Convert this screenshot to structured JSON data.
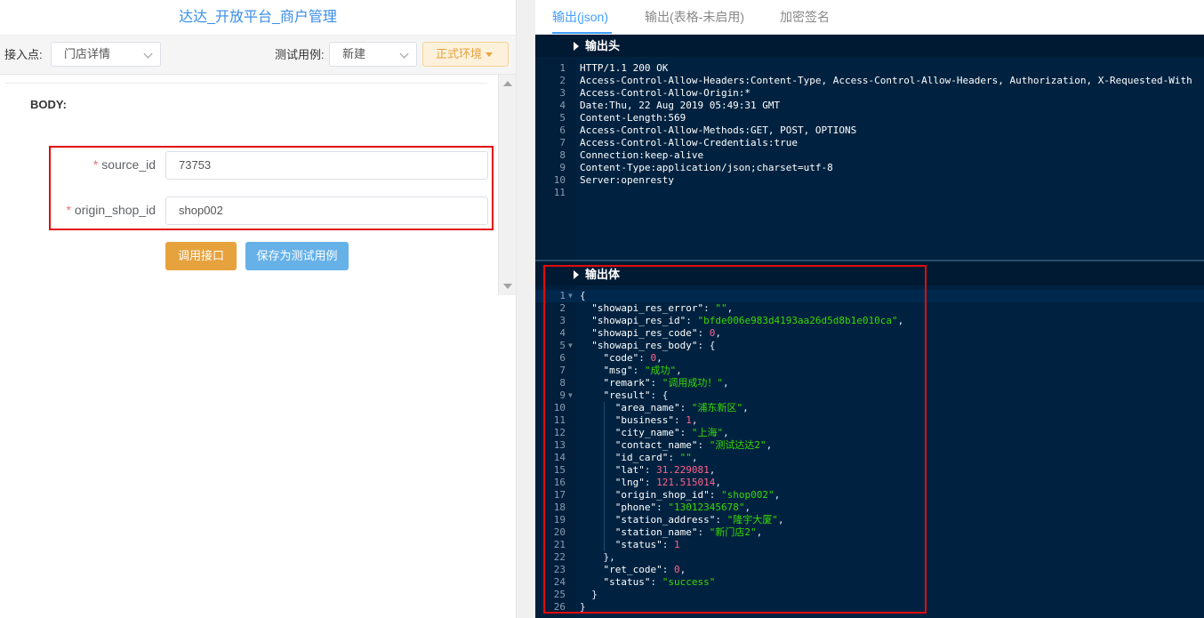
{
  "left": {
    "app_title": "达达_开放平台_商户管理",
    "access_point_label": "接入点:",
    "access_point_value": "门店详情",
    "test_case_label": "测试用例:",
    "test_case_value": "新建",
    "env_button": "正式环境",
    "body_title": "BODY:",
    "fields": [
      {
        "label": "source_id",
        "value": "73753"
      },
      {
        "label": "origin_shop_id",
        "value": "shop002"
      }
    ],
    "call_button": "调用接口",
    "save_button": "保存为测试用例"
  },
  "right": {
    "tabs": [
      {
        "label": "输出(json)"
      },
      {
        "label": "输出(表格-未启用)"
      },
      {
        "label": "加密签名"
      }
    ],
    "header_section_title": "输出头",
    "body_section_title": "输出体",
    "header_lines": [
      "HTTP/1.1 200 OK",
      "Access-Control-Allow-Headers:Content-Type, Access-Control-Allow-Headers, Authorization, X-Requested-With",
      "Access-Control-Allow-Origin:*",
      "Date:Thu, 22 Aug 2019 05:49:31 GMT",
      "Content-Length:569",
      "Access-Control-Allow-Methods:GET, POST, OPTIONS",
      "Access-Control-Allow-Credentials:true",
      "Connection:keep-alive",
      "Content-Type:application/json;charset=utf-8",
      "Server:openresty",
      ""
    ],
    "body_lines": [
      [
        {
          "t": "p",
          "v": "{"
        }
      ],
      [
        {
          "t": "p",
          "v": "  "
        },
        {
          "t": "k",
          "v": "\"showapi_res_error\""
        },
        {
          "t": "p",
          "v": ": "
        },
        {
          "t": "s",
          "v": "\"\""
        },
        {
          "t": "p",
          "v": ","
        }
      ],
      [
        {
          "t": "p",
          "v": "  "
        },
        {
          "t": "k",
          "v": "\"showapi_res_id\""
        },
        {
          "t": "p",
          "v": ": "
        },
        {
          "t": "s",
          "v": "\"bfde006e983d4193aa26d5d8b1e010ca\""
        },
        {
          "t": "p",
          "v": ","
        }
      ],
      [
        {
          "t": "p",
          "v": "  "
        },
        {
          "t": "k",
          "v": "\"showapi_res_code\""
        },
        {
          "t": "p",
          "v": ": "
        },
        {
          "t": "n",
          "v": "0"
        },
        {
          "t": "p",
          "v": ","
        }
      ],
      [
        {
          "t": "p",
          "v": "  "
        },
        {
          "t": "k",
          "v": "\"showapi_res_body\""
        },
        {
          "t": "p",
          "v": ": {"
        }
      ],
      [
        {
          "t": "p",
          "v": "    "
        },
        {
          "t": "k",
          "v": "\"code\""
        },
        {
          "t": "p",
          "v": ": "
        },
        {
          "t": "n",
          "v": "0"
        },
        {
          "t": "p",
          "v": ","
        }
      ],
      [
        {
          "t": "p",
          "v": "    "
        },
        {
          "t": "k",
          "v": "\"msg\""
        },
        {
          "t": "p",
          "v": ": "
        },
        {
          "t": "s",
          "v": "\"成功\""
        },
        {
          "t": "p",
          "v": ","
        }
      ],
      [
        {
          "t": "p",
          "v": "    "
        },
        {
          "t": "k",
          "v": "\"remark\""
        },
        {
          "t": "p",
          "v": ": "
        },
        {
          "t": "s",
          "v": "\"调用成功！\""
        },
        {
          "t": "p",
          "v": ","
        }
      ],
      [
        {
          "t": "p",
          "v": "    "
        },
        {
          "t": "k",
          "v": "\"result\""
        },
        {
          "t": "p",
          "v": ": {"
        }
      ],
      [
        {
          "t": "p",
          "v": "      "
        },
        {
          "t": "k",
          "v": "\"area_name\""
        },
        {
          "t": "p",
          "v": ": "
        },
        {
          "t": "s",
          "v": "\"浦东新区\""
        },
        {
          "t": "p",
          "v": ","
        }
      ],
      [
        {
          "t": "p",
          "v": "      "
        },
        {
          "t": "k",
          "v": "\"business\""
        },
        {
          "t": "p",
          "v": ": "
        },
        {
          "t": "n",
          "v": "1"
        },
        {
          "t": "p",
          "v": ","
        }
      ],
      [
        {
          "t": "p",
          "v": "      "
        },
        {
          "t": "k",
          "v": "\"city_name\""
        },
        {
          "t": "p",
          "v": ": "
        },
        {
          "t": "s",
          "v": "\"上海\""
        },
        {
          "t": "p",
          "v": ","
        }
      ],
      [
        {
          "t": "p",
          "v": "      "
        },
        {
          "t": "k",
          "v": "\"contact_name\""
        },
        {
          "t": "p",
          "v": ": "
        },
        {
          "t": "s",
          "v": "\"测试达达2\""
        },
        {
          "t": "p",
          "v": ","
        }
      ],
      [
        {
          "t": "p",
          "v": "      "
        },
        {
          "t": "k",
          "v": "\"id_card\""
        },
        {
          "t": "p",
          "v": ": "
        },
        {
          "t": "s",
          "v": "\"\""
        },
        {
          "t": "p",
          "v": ","
        }
      ],
      [
        {
          "t": "p",
          "v": "      "
        },
        {
          "t": "k",
          "v": "\"lat\""
        },
        {
          "t": "p",
          "v": ": "
        },
        {
          "t": "n",
          "v": "31.229081"
        },
        {
          "t": "p",
          "v": ","
        }
      ],
      [
        {
          "t": "p",
          "v": "      "
        },
        {
          "t": "k",
          "v": "\"lng\""
        },
        {
          "t": "p",
          "v": ": "
        },
        {
          "t": "n",
          "v": "121.515014"
        },
        {
          "t": "p",
          "v": ","
        }
      ],
      [
        {
          "t": "p",
          "v": "      "
        },
        {
          "t": "k",
          "v": "\"origin_shop_id\""
        },
        {
          "t": "p",
          "v": ": "
        },
        {
          "t": "s",
          "v": "\"shop002\""
        },
        {
          "t": "p",
          "v": ","
        }
      ],
      [
        {
          "t": "p",
          "v": "      "
        },
        {
          "t": "k",
          "v": "\"phone\""
        },
        {
          "t": "p",
          "v": ": "
        },
        {
          "t": "s",
          "v": "\"13012345678\""
        },
        {
          "t": "p",
          "v": ","
        }
      ],
      [
        {
          "t": "p",
          "v": "      "
        },
        {
          "t": "k",
          "v": "\"station_address\""
        },
        {
          "t": "p",
          "v": ": "
        },
        {
          "t": "s",
          "v": "\"隆宇大厦\""
        },
        {
          "t": "p",
          "v": ","
        }
      ],
      [
        {
          "t": "p",
          "v": "      "
        },
        {
          "t": "k",
          "v": "\"station_name\""
        },
        {
          "t": "p",
          "v": ": "
        },
        {
          "t": "s",
          "v": "\"新门店2\""
        },
        {
          "t": "p",
          "v": ","
        }
      ],
      [
        {
          "t": "p",
          "v": "      "
        },
        {
          "t": "k",
          "v": "\"status\""
        },
        {
          "t": "p",
          "v": ": "
        },
        {
          "t": "n",
          "v": "1"
        }
      ],
      [
        {
          "t": "p",
          "v": "    },"
        }
      ],
      [
        {
          "t": "p",
          "v": "    "
        },
        {
          "t": "k",
          "v": "\"ret_code\""
        },
        {
          "t": "p",
          "v": ": "
        },
        {
          "t": "n",
          "v": "0"
        },
        {
          "t": "p",
          "v": ","
        }
      ],
      [
        {
          "t": "p",
          "v": "    "
        },
        {
          "t": "k",
          "v": "\"status\""
        },
        {
          "t": "p",
          "v": ": "
        },
        {
          "t": "s",
          "v": "\"success\""
        }
      ],
      [
        {
          "t": "p",
          "v": "  }"
        }
      ],
      [
        {
          "t": "p",
          "v": "}"
        }
      ]
    ],
    "fold_lines": [
      1,
      5,
      9
    ]
  }
}
